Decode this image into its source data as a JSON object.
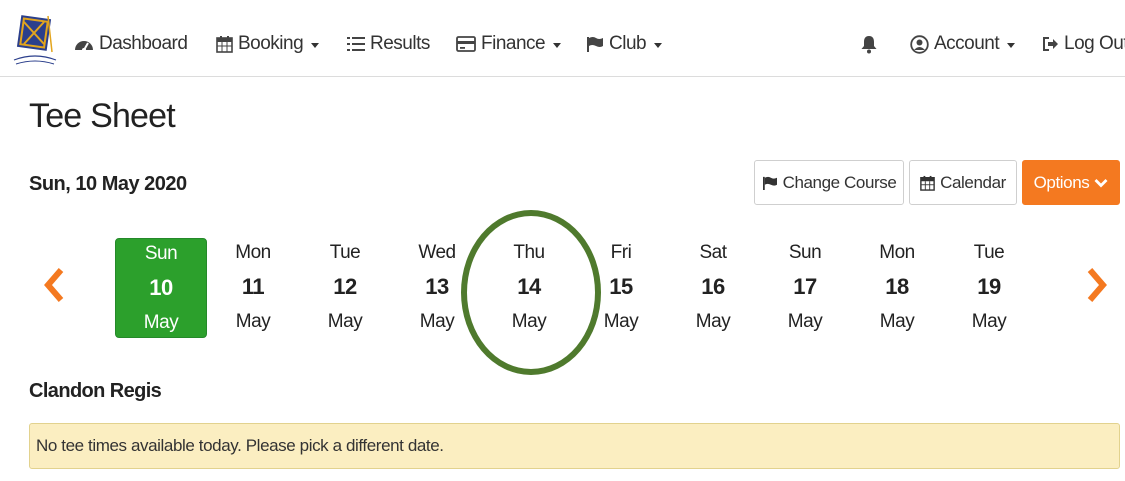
{
  "brand": {
    "logo_letters": "CRGC",
    "logo_script": "Clandon Regis"
  },
  "nav": {
    "dashboard": "Dashboard",
    "booking": "Booking",
    "results": "Results",
    "finance": "Finance",
    "club": "Club",
    "account": "Account",
    "logout": "Log Out"
  },
  "page": {
    "title": "Tee Sheet",
    "date": "Sun, 10 May 2020"
  },
  "buttons": {
    "change_course": "Change Course",
    "calendar": "Calendar",
    "options": "Options"
  },
  "days": [
    {
      "dow": "Sun",
      "num": "10",
      "month": "May",
      "selected": true
    },
    {
      "dow": "Mon",
      "num": "11",
      "month": "May"
    },
    {
      "dow": "Tue",
      "num": "12",
      "month": "May"
    },
    {
      "dow": "Wed",
      "num": "13",
      "month": "May"
    },
    {
      "dow": "Thu",
      "num": "14",
      "month": "May",
      "circled": true
    },
    {
      "dow": "Fri",
      "num": "15",
      "month": "May"
    },
    {
      "dow": "Sat",
      "num": "16",
      "month": "May"
    },
    {
      "dow": "Sun",
      "num": "17",
      "month": "May"
    },
    {
      "dow": "Mon",
      "num": "18",
      "month": "May"
    },
    {
      "dow": "Tue",
      "num": "19",
      "month": "May"
    }
  ],
  "course": {
    "name": "Clandon Regis"
  },
  "alert": {
    "message": "No tee times available today. Please pick a different date."
  },
  "colors": {
    "accent": "#f47920",
    "selected_day": "#2ca02c",
    "alert_bg": "#fbeec1",
    "ring": "#4f7a2d"
  }
}
